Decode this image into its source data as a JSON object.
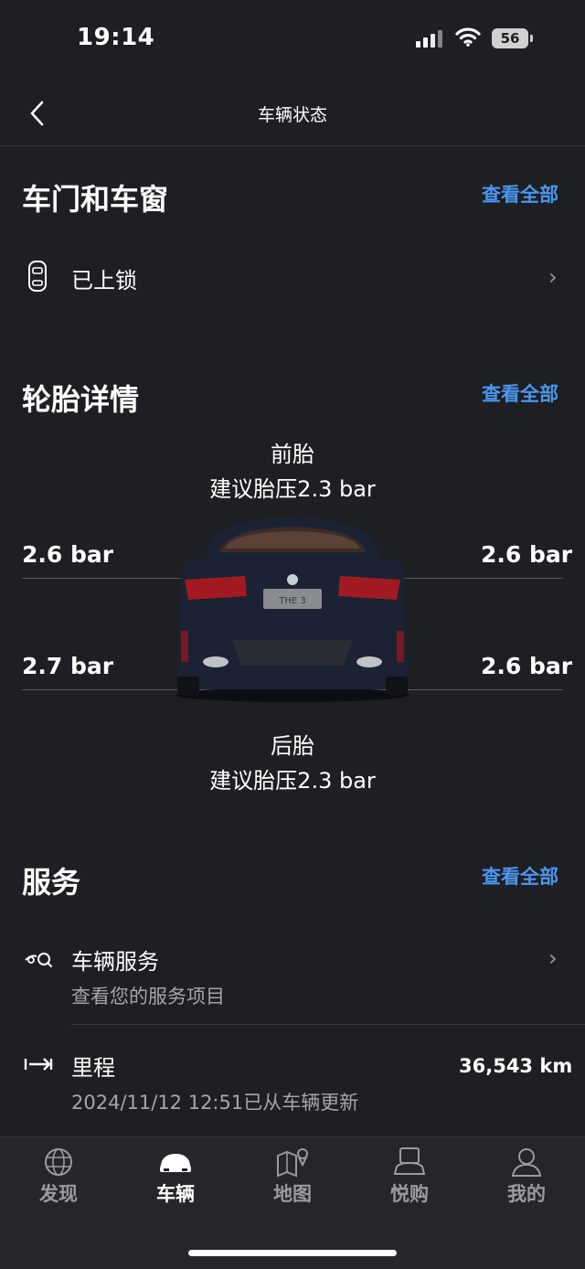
{
  "status_bar": {
    "time": "19:14",
    "battery": "56"
  },
  "nav": {
    "title": "车辆状态"
  },
  "doors": {
    "title": "车门和车窗",
    "view_all": "查看全部",
    "status": "已上锁"
  },
  "tires": {
    "title": "轮胎详情",
    "view_all": "查看全部",
    "front_label": "前胎",
    "front_recommended": "建议胎压2.3 bar",
    "front_left": "2.6 bar",
    "front_right": "2.6 bar",
    "rear_left": "2.7 bar",
    "rear_right": "2.6 bar",
    "rear_label": "后胎",
    "rear_recommended": "建议胎压2.3 bar"
  },
  "service": {
    "title": "服务",
    "view_all": "查看全部",
    "vehicle_service": {
      "title": "车辆服务",
      "subtitle": "查看您的服务项目"
    },
    "mileage": {
      "title": "里程",
      "value": "36,543 km",
      "subtitle": "2024/11/12 12:51已从车辆更新"
    }
  },
  "tabbar": {
    "discover": "发现",
    "vehicle": "车辆",
    "map": "地图",
    "shop": "悦购",
    "me": "我的"
  },
  "colors": {
    "accent": "#4b96f0",
    "background": "#1e1f22",
    "car_body": "#1b2233"
  }
}
